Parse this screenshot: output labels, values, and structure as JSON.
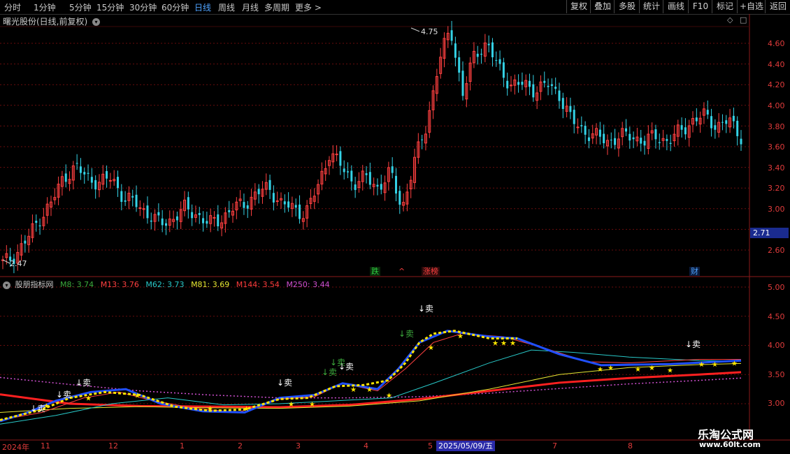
{
  "toolbar": {
    "periods": [
      "分时",
      "1分钟",
      "5分钟",
      "15分钟",
      "30分钟",
      "60分钟",
      "日线",
      "周线",
      "月线",
      "多周期",
      "更多 >"
    ],
    "active_period": "日线",
    "right_buttons": [
      "复权",
      "叠加",
      "多股",
      "统计",
      "画线",
      "F10",
      "标记",
      "+自选",
      "返回"
    ]
  },
  "chart": {
    "title": "曙光股份(日线,前复权)",
    "high_label": "4.75",
    "low_label": "2.47",
    "current_price": "2.71",
    "price_axis": [
      "4.60",
      "4.40",
      "4.20",
      "4.00",
      "3.80",
      "3.60",
      "3.40",
      "3.20",
      "3.00",
      "2.60"
    ],
    "tags": [
      {
        "text": "跌",
        "color": "#2ecc40"
      },
      {
        "text": "^",
        "color": "#ff4040"
      },
      {
        "text": "涨榜",
        "color": "#ff4040"
      },
      {
        "text": "财",
        "color": "#4fa3ff"
      }
    ]
  },
  "indicator": {
    "name": "股朋指标网",
    "legend": [
      {
        "label": "M8: 3.74",
        "color": "#3caa3c"
      },
      {
        "label": "M13: 3.76",
        "color": "#ff4040"
      },
      {
        "label": "M62: 3.73",
        "color": "#28c8c8"
      },
      {
        "label": "M81: 3.69",
        "color": "#e6e632"
      },
      {
        "label": "M144: 3.54",
        "color": "#ff3c3c"
      },
      {
        "label": "M250: 3.44",
        "color": "#d050d0"
      }
    ],
    "axis": [
      "5.00",
      "4.50",
      "4.00",
      "3.50",
      "3.00"
    ],
    "sell_label": "↓卖"
  },
  "xaxis": {
    "labels": [
      "2024年",
      "11",
      "12",
      "1",
      "2",
      "3",
      "4",
      "5",
      "7",
      "8"
    ],
    "highlight_date": "2025/05/09/五"
  },
  "watermark": {
    "line1": "乐淘公式网",
    "line2": "www.60lt.com"
  },
  "colors": {
    "up": "#ff4040",
    "down": "#34d2e6",
    "grid": "#6a0d0d",
    "axis_text": "#e03b3b"
  },
  "chart_data": {
    "type": "candlestick",
    "ylim": [
      2.5,
      4.8
    ],
    "indicator_ylim": [
      2.75,
      5.15
    ],
    "ma_values_last": {
      "M8": 3.74,
      "M13": 3.76,
      "M62": 3.73,
      "M81": 3.69,
      "M144": 3.54,
      "M250": 3.44
    },
    "approx_close_path": [
      2.47,
      2.55,
      2.7,
      2.9,
      3.05,
      3.3,
      3.4,
      3.3,
      3.25,
      3.3,
      3.1,
      3.05,
      2.95,
      2.85,
      2.9,
      3.0,
      2.95,
      2.85,
      2.9,
      3.0,
      3.05,
      3.15,
      3.2,
      3.05,
      3.0,
      2.95,
      3.2,
      3.55,
      3.4,
      3.25,
      3.3,
      3.2,
      3.35,
      3.0,
      3.45,
      3.8,
      4.4,
      4.75,
      4.1,
      4.5,
      4.6,
      4.35,
      4.2,
      4.2,
      4.15,
      4.2,
      4.1,
      3.85,
      3.75,
      3.7,
      3.65,
      3.7,
      3.7,
      3.65,
      3.7,
      3.65,
      3.75,
      3.85,
      3.9,
      3.8,
      3.85,
      3.7
    ]
  }
}
